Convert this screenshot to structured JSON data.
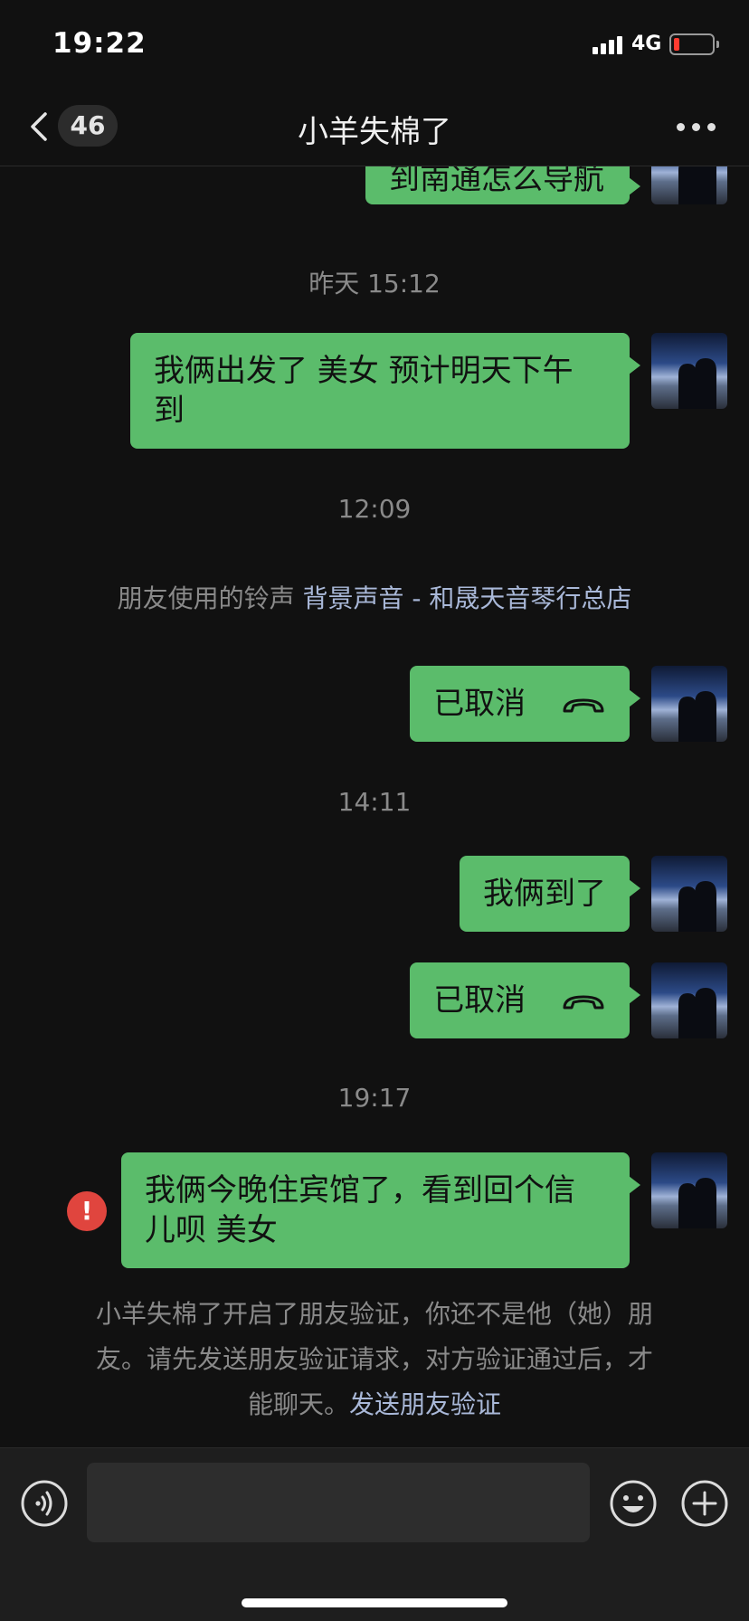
{
  "status_bar": {
    "time": "19:22",
    "network": "4G"
  },
  "nav": {
    "unread_count": "46",
    "title": "小羊失棉了"
  },
  "messages": {
    "m0": "到南通怎么导航",
    "t1": "昨天 15:12",
    "m1_line1": "我俩出发了 美女  预计明天下午",
    "m1_line2": "到",
    "t2": "12:09",
    "ringtone_prefix": "朋友使用的铃声 ",
    "ringtone_link": "背景声音 - 和晟天音琴行总店",
    "m2": "已取消",
    "t3": "14:11",
    "m3": "我俩到了",
    "m4": "已取消",
    "t4": "19:17",
    "m5_line1": "我俩今晚住宾馆了，看到回个信",
    "m5_line2": "儿呗  美女"
  },
  "verify": {
    "line1": "小羊失棉了开启了朋友验证，你还不是他（她）朋",
    "line2": "友。请先发送朋友验证请求，对方验证通过后，才",
    "line3_prefix": "能聊天。",
    "link": "发送朋友验证"
  },
  "input": {
    "placeholder": ""
  },
  "colors": {
    "bubble": "#5bbc6b",
    "background": "#111111",
    "link": "#a9b8d8",
    "error": "#e0453e"
  },
  "icons": [
    "back-icon",
    "more-icon",
    "phone-hangup-icon",
    "error-icon",
    "voice-icon",
    "emoji-icon",
    "plus-icon"
  ]
}
